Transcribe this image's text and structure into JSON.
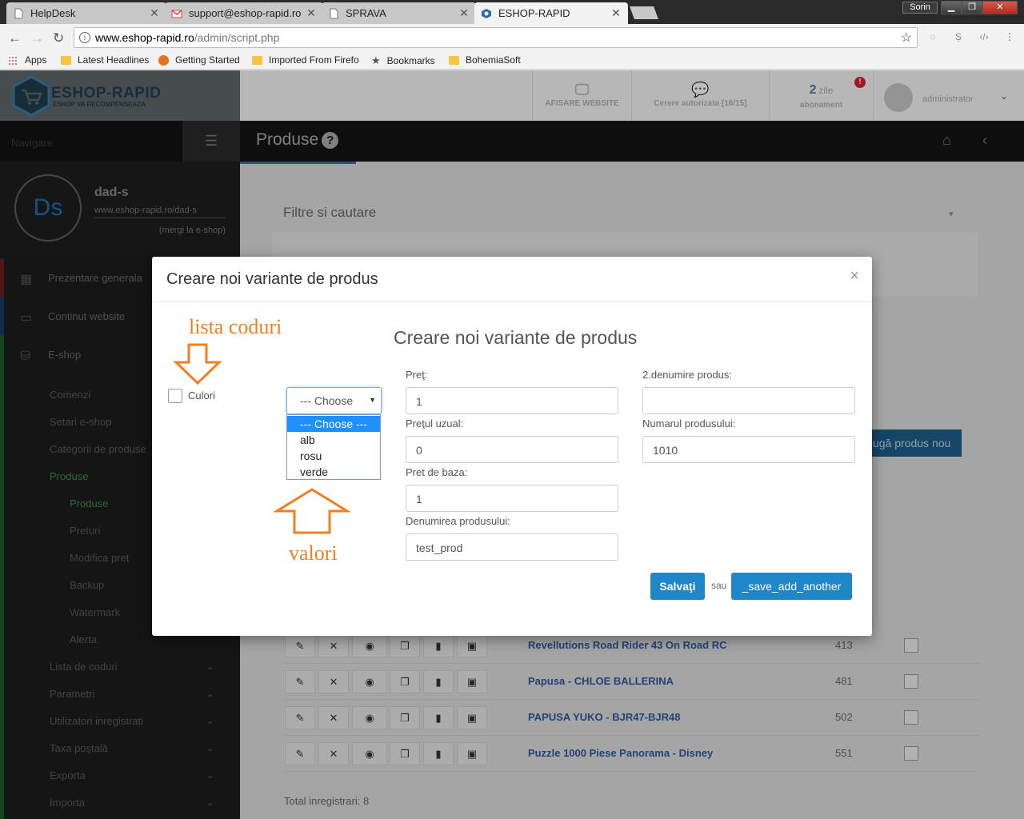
{
  "browser": {
    "tabs": [
      {
        "title": "HelpDesk",
        "icon": "page-icon"
      },
      {
        "title": "support@eshop-rapid.ro",
        "icon": "gmail-icon"
      },
      {
        "title": "SPRAVA",
        "icon": "page-icon"
      },
      {
        "title": "ESHOP-RAPID",
        "icon": "eshop-icon"
      }
    ],
    "window_user": "Sorin",
    "url_host": "www.eshop-rapid.ro",
    "url_path": "/admin/script.php",
    "bookmarks": [
      "Apps",
      "Latest Headlines",
      "Getting Started",
      "Imported From Firefo",
      "Bookmarks",
      "BohemiaSoft"
    ]
  },
  "header": {
    "logo_title": "ESHOP-RAPID",
    "logo_subtitle": "ESHOP VA RECOMPENSEAZA",
    "afisare": "AFISARE WEBSITE",
    "cerere": "Cerere autorizata [16/15]",
    "zile_num": "2",
    "zile_word": "zile",
    "abonament": "abonament",
    "user": "administrator"
  },
  "sidebar": {
    "nav_label": "Navigare",
    "profile_initials": "Ds",
    "profile_name": "dad-s",
    "profile_url": "www.eshop-rapid.ro/dad-s",
    "profile_link": "(mergi la e-shop)",
    "menu": [
      "Prezentare generala",
      "Continut website",
      "E-shop"
    ],
    "sub": [
      "Comenzi",
      "Setari e-shop",
      "Categorii de produse",
      "Produse"
    ],
    "deep": [
      "Produse",
      "Preturi",
      "Modifica pret",
      "Backup",
      "Watermark",
      "Alerta"
    ],
    "more": [
      "Lista de coduri",
      "Parametri",
      "Utilizatori inregistrati",
      "Taxa poştală",
      "Exporta",
      "Importa"
    ]
  },
  "main": {
    "title": "Produse",
    "panel_title": "Filtre si cautare",
    "add_button": "ugă produs nou",
    "rows": [
      {
        "name": "Revellutions Road Rider 43 On Road RC",
        "num": "413"
      },
      {
        "name": "Papusa - CHLOE BALLERINA",
        "num": "481"
      },
      {
        "name": "PAPUSA YUKO - BJR47-BJR48",
        "num": "502"
      },
      {
        "name": "Puzzle 1000 Piese Panorama - Disney",
        "num": "551"
      }
    ],
    "total": "Total inregistrari: 8"
  },
  "modal": {
    "title": "Creare noi variante de produs",
    "heading": "Creare noi variante de produs",
    "annotation_top": "lista coduri",
    "annotation_bottom": "valori",
    "checkbox_label": "Culori",
    "select_value": "--- Choose",
    "options": [
      "--- Choose ---",
      "alb",
      "rosu",
      "verde"
    ],
    "fields": {
      "pret_label": "Preţ:",
      "pret_value": "1",
      "pret_uzual_label": "Preţul uzual:",
      "pret_uzual_value": "0",
      "pret_baza_label": "Pret de baza:",
      "pret_baza_value": "1",
      "denumire_label": "Denumirea produsului:",
      "denumire_value": "test_prod",
      "denumire2_label": "2.denumire produs:",
      "denumire2_value": "",
      "numar_label": "Numarul produsului:",
      "numar_value": "1010"
    },
    "save_button": "Salvaţi",
    "sau": "sau",
    "save_another_button": "_save_add_another"
  },
  "colors": {
    "accent": "#1f87c8",
    "annotation": "#f07f22",
    "link": "#2d5aa0",
    "sidebar_active": "#3f8a4a"
  }
}
